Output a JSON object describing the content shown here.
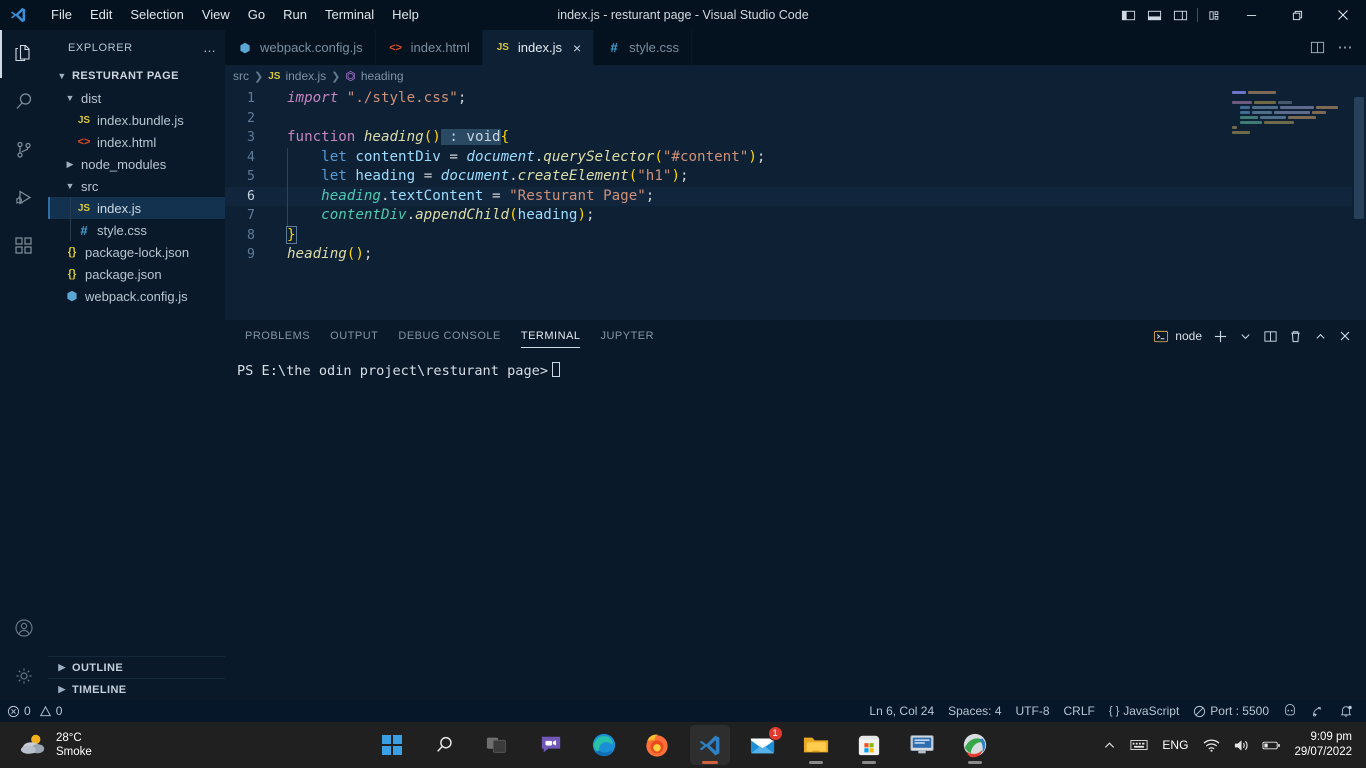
{
  "titlebar": {
    "logo": "vscode-logo",
    "menus": [
      "File",
      "Edit",
      "Selection",
      "View",
      "Go",
      "Run",
      "Terminal",
      "Help"
    ],
    "window_title": "index.js - resturant page - Visual Studio Code",
    "layout_buttons": [
      {
        "name": "toggle-primary-sidebar",
        "label": "primary-sidebar-icon"
      },
      {
        "name": "toggle-panel",
        "label": "panel-icon"
      },
      {
        "name": "toggle-secondary-sidebar",
        "label": "secondary-sidebar-icon"
      },
      {
        "name": "customize-layout",
        "label": "customize-layout-icon"
      }
    ],
    "window_controls": [
      "minimize",
      "restore",
      "close"
    ]
  },
  "activitybar": {
    "items": [
      {
        "name": "explorer",
        "icon": "files-icon",
        "active": true
      },
      {
        "name": "search",
        "icon": "search-icon",
        "active": false
      },
      {
        "name": "source-control",
        "icon": "source-control-icon",
        "active": false
      },
      {
        "name": "run-and-debug",
        "icon": "debug-icon",
        "active": false
      },
      {
        "name": "extensions",
        "icon": "extensions-icon",
        "active": false
      }
    ],
    "bottom": [
      {
        "name": "accounts",
        "icon": "account-icon"
      },
      {
        "name": "manage",
        "icon": "gear-icon"
      }
    ]
  },
  "sidebar": {
    "title": "EXPLORER",
    "more_actions": "…",
    "root_folder": "RESTURANT PAGE",
    "tree": [
      {
        "label": "dist",
        "type": "folder",
        "expanded": true,
        "depth": 1,
        "icon": "chevron-down-icon"
      },
      {
        "label": "index.bundle.js",
        "type": "js",
        "depth": 2,
        "icon": "js-icon"
      },
      {
        "label": "index.html",
        "type": "html",
        "depth": 2,
        "icon": "html-icon"
      },
      {
        "label": "node_modules",
        "type": "folder",
        "expanded": false,
        "depth": 1,
        "icon": "chevron-right-icon"
      },
      {
        "label": "src",
        "type": "folder",
        "expanded": true,
        "depth": 1,
        "icon": "chevron-down-icon"
      },
      {
        "label": "index.js",
        "type": "js",
        "depth": 2,
        "icon": "js-icon",
        "selected": true
      },
      {
        "label": "style.css",
        "type": "css",
        "depth": 2,
        "icon": "css-icon"
      },
      {
        "label": "package-lock.json",
        "type": "json",
        "depth": 1,
        "icon": "json-icon"
      },
      {
        "label": "package.json",
        "type": "json",
        "depth": 1,
        "icon": "json-icon"
      },
      {
        "label": "webpack.config.js",
        "type": "webpack",
        "depth": 1,
        "icon": "webpack-icon"
      }
    ],
    "sections": [
      {
        "label": "OUTLINE",
        "expanded": false
      },
      {
        "label": "TIMELINE",
        "expanded": false
      }
    ]
  },
  "editor": {
    "tabs": [
      {
        "label": "webpack.config.js",
        "icon": "webpack-icon",
        "active": false,
        "dirty": false
      },
      {
        "label": "index.html",
        "icon": "html-icon",
        "active": false,
        "dirty": false
      },
      {
        "label": "index.js",
        "icon": "js-icon",
        "active": true,
        "close": "×"
      },
      {
        "label": "style.css",
        "icon": "css-icon",
        "active": false,
        "dirty": false
      }
    ],
    "tab_actions": [
      {
        "name": "split-editor",
        "icon": "split-editor-icon"
      },
      {
        "name": "more-actions",
        "icon": "ellipsis-icon"
      }
    ],
    "breadcrumb": [
      {
        "label": "src",
        "icon": null
      },
      {
        "label": "index.js",
        "icon": "js-icon"
      },
      {
        "label": "heading",
        "icon": "symbol-function-icon"
      }
    ],
    "code_lines": [
      {
        "num": 1,
        "active": false
      },
      {
        "num": 2,
        "active": false
      },
      {
        "num": 3,
        "active": false
      },
      {
        "num": 4,
        "active": false
      },
      {
        "num": 5,
        "active": false
      },
      {
        "num": 6,
        "active": true
      },
      {
        "num": 7,
        "active": false
      },
      {
        "num": 8,
        "active": false
      },
      {
        "num": 9,
        "active": false
      }
    ],
    "code_text": [
      "import \"./style.css\";",
      "",
      "function heading() : void{",
      "    let contentDiv = document.querySelector(\"#content\");",
      "    let heading = document.createElement(\"h1\");",
      "    heading.textContent = \"Resturant Page\";",
      "    contentDiv.appendChild(heading);",
      "}",
      "heading();"
    ]
  },
  "panel": {
    "tabs": [
      {
        "label": "PROBLEMS",
        "active": false
      },
      {
        "label": "OUTPUT",
        "active": false
      },
      {
        "label": "DEBUG CONSOLE",
        "active": false
      },
      {
        "label": "TERMINAL",
        "active": true
      },
      {
        "label": "JUPYTER",
        "active": false
      }
    ],
    "shell_name": "node",
    "shell_icon": "terminal-icon",
    "actions": [
      {
        "name": "new-terminal",
        "icon": "plus-icon"
      },
      {
        "name": "terminal-dropdown",
        "icon": "chevron-down-icon"
      },
      {
        "name": "split-terminal",
        "icon": "split-icon"
      },
      {
        "name": "kill-terminal",
        "icon": "trash-icon"
      },
      {
        "name": "maximize-panel",
        "icon": "chevron-up-icon"
      },
      {
        "name": "close-panel",
        "icon": "close-icon"
      }
    ],
    "terminal_prompt": "PS E:\\the odin project\\resturant page>"
  },
  "statusbar": {
    "errors": "0",
    "warnings": "0",
    "error_icon": "error-circle-icon",
    "warning_icon": "warning-triangle-icon",
    "right_items": [
      {
        "name": "cursor-position",
        "label": "Ln 6, Col 24"
      },
      {
        "name": "indentation",
        "label": "Spaces: 4"
      },
      {
        "name": "encoding",
        "label": "UTF-8"
      },
      {
        "name": "eol",
        "label": "CRLF"
      },
      {
        "name": "language-mode",
        "label": "JavaScript",
        "icon": "braces-icon"
      },
      {
        "name": "live-server-port",
        "label": "Port : 5500",
        "icon": "broadcast-icon"
      }
    ],
    "right_icons": [
      {
        "name": "feedback",
        "icon": "smiley-icon"
      },
      {
        "name": "remote-window",
        "icon": "remote-icon"
      },
      {
        "name": "notifications",
        "icon": "bell-icon"
      }
    ]
  },
  "taskbar": {
    "weather": {
      "temperature": "28°C",
      "condition": "Smoke",
      "icon": "sun-cloud-icon"
    },
    "apps": [
      {
        "name": "start",
        "icon": "windows-icon"
      },
      {
        "name": "search",
        "icon": "search-icon"
      },
      {
        "name": "task-view",
        "icon": "task-view-icon"
      },
      {
        "name": "chat",
        "icon": "chat-icon"
      },
      {
        "name": "microsoft-edge",
        "icon": "edge-icon",
        "running": true
      },
      {
        "name": "firefox",
        "icon": "firefox-icon",
        "running": true
      },
      {
        "name": "visual-studio-code",
        "icon": "vscode-icon",
        "running": true,
        "active": true
      },
      {
        "name": "mail",
        "icon": "mail-icon",
        "badge": "1"
      },
      {
        "name": "file-explorer",
        "icon": "folder-icon",
        "running": true
      },
      {
        "name": "microsoft-store",
        "icon": "store-icon",
        "running": true
      },
      {
        "name": "remote-desktop",
        "icon": "monitor-icon"
      },
      {
        "name": "photos",
        "icon": "photos-icon",
        "running": true
      }
    ],
    "tray": {
      "overflow": "chevron-up-icon",
      "ime": "keyboard-icon",
      "language": "ENG",
      "network": "wifi-icon",
      "volume": "speaker-icon",
      "battery": "battery-icon",
      "time": "9:09 pm",
      "date": "29/07/2022"
    }
  }
}
